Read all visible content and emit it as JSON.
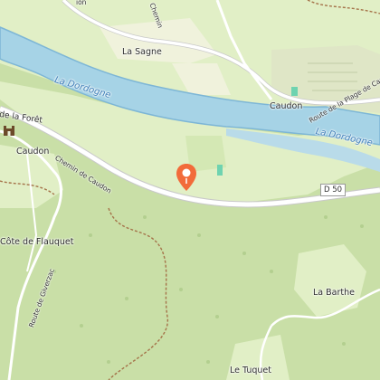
{
  "map": {
    "colors": {
      "forest": "#c9dfa7",
      "meadow": "#e1efc6",
      "field": "#f0f2dc",
      "water": "#a6d3e6",
      "river_edge": "#7db6d6",
      "road": "#ffffff",
      "road_casing": "#c9c9c9",
      "trail": "#a5734a",
      "marker": "#f26b3a"
    },
    "labels": {
      "la_sagne": "La Sagne",
      "la_dordogne_1": "La Dordogne",
      "la_dordogne_2": "La Dordogne",
      "caudon_east": "Caudon",
      "caudon_west": "Caudon",
      "route_plage": "Route de la Plage de Caudon",
      "de_la_foret": "de la Forêt",
      "chemin_caudon": "Chemin de Caudon",
      "cote_flauquet": "Côte de Flauquet",
      "route_giverzac": "Route de Giverzac",
      "la_barthe": "La Barthe",
      "le_tuquet": "Le Tuquet",
      "top_left_fragment": "ion",
      "top_chemin_fragment": "Chemin"
    },
    "road_shield": "D 50",
    "icons": [
      "location-pin-icon",
      "castle-icon"
    ]
  }
}
